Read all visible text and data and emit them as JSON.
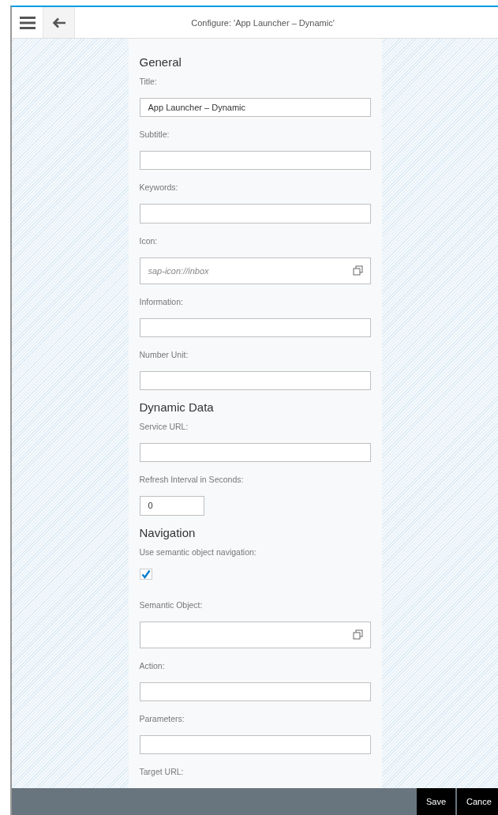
{
  "header": {
    "title": "Configure: 'App Launcher – Dynamic'"
  },
  "sections": [
    {
      "heading": "General",
      "fields": [
        {
          "label": "Title:",
          "kind": "text",
          "value": "App Launcher – Dynamic"
        },
        {
          "label": "Subtitle:",
          "kind": "text"
        },
        {
          "label": "Keywords:",
          "kind": "text"
        },
        {
          "label": "Icon:",
          "kind": "value-help",
          "placeholder": "sap-icon://inbox"
        },
        {
          "label": "Information:",
          "kind": "text"
        },
        {
          "label": "Number Unit:",
          "kind": "text"
        }
      ]
    },
    {
      "heading": "Dynamic Data",
      "fields": [
        {
          "label": "Service URL:",
          "kind": "text"
        },
        {
          "label": "Refresh Interval in Seconds:",
          "kind": "number",
          "value": "0"
        }
      ]
    },
    {
      "heading": "Navigation",
      "fields": [
        {
          "label": "Use semantic object navigation:",
          "kind": "checkbox",
          "checked": true
        },
        {
          "label": "Semantic Object:",
          "kind": "value-help"
        },
        {
          "label": "Action:",
          "kind": "text"
        },
        {
          "label": "Parameters:",
          "kind": "text"
        }
      ],
      "partial_label": "Target URL:"
    }
  ],
  "footer": {
    "buttons": [
      "Save",
      "Cance"
    ]
  }
}
